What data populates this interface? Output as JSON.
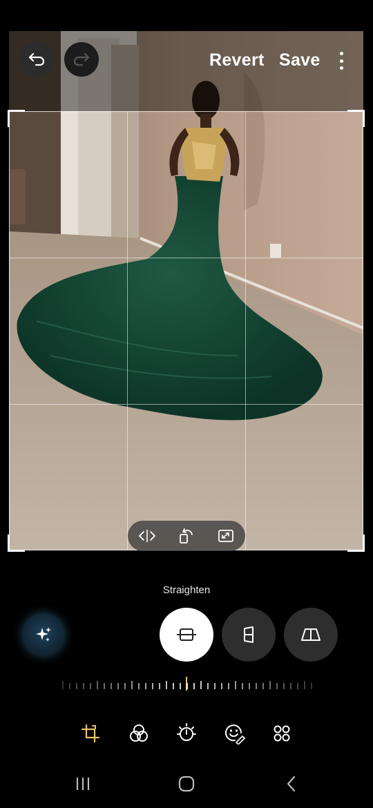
{
  "toolbar": {
    "revert_label": "Revert",
    "save_label": "Save",
    "undo_icon": "undo-arrow-icon",
    "redo_icon": "redo-arrow-icon",
    "more_icon": "more-vertical-icon"
  },
  "image": {
    "description_icon": "photo-canvas"
  },
  "crop_tools": [
    "flip-icon",
    "rotate-icon",
    "free-aspect-icon"
  ],
  "straighten": {
    "title": "Straighten",
    "buttons": [
      "straighten-icon",
      "vertical-perspective-icon",
      "horizontal-perspective-icon"
    ],
    "selected": "straighten-icon",
    "dial_value": 0
  },
  "edit_tools": [
    "transform-icon",
    "filters-icon",
    "tone-icon",
    "decorations-icon",
    "more-tools-icon"
  ],
  "colors": {
    "accent": "#e8c26a",
    "background": "#000000"
  },
  "nav": [
    "recents-icon",
    "home-icon",
    "back-icon"
  ]
}
